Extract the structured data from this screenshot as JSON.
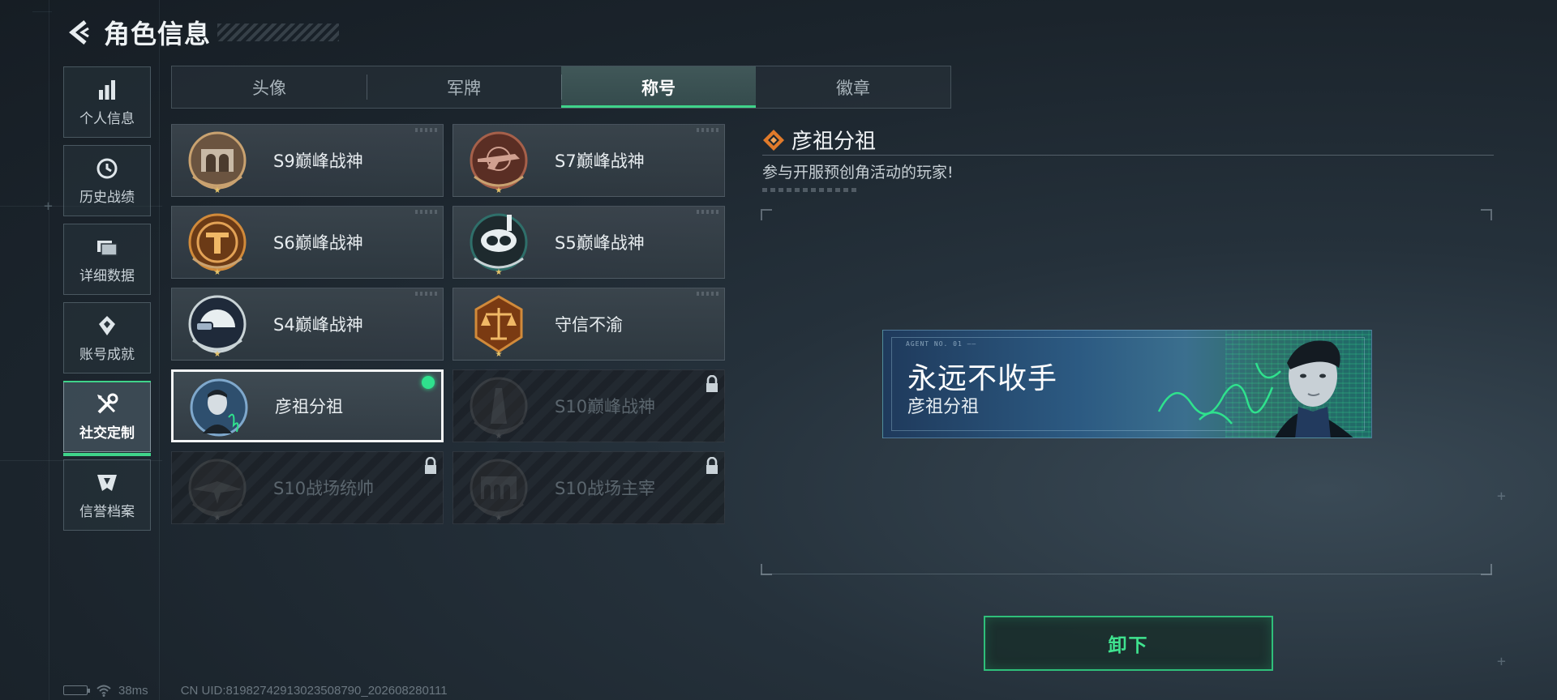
{
  "header": {
    "title": "角色信息"
  },
  "sidebar": {
    "items": [
      {
        "label": "个人信息",
        "icon": "bar-chart-icon",
        "active": false
      },
      {
        "label": "历史战绩",
        "icon": "clock-icon",
        "active": false
      },
      {
        "label": "详细数据",
        "icon": "folder-icon",
        "active": false
      },
      {
        "label": "账号成就",
        "icon": "achievement-icon",
        "active": false
      },
      {
        "label": "社交定制",
        "icon": "tools-icon",
        "active": true
      },
      {
        "label": "信誉档案",
        "icon": "credit-shield-icon",
        "active": false
      }
    ]
  },
  "tabs": [
    {
      "label": "头像",
      "active": false
    },
    {
      "label": "军牌",
      "active": false
    },
    {
      "label": "称号",
      "active": true
    },
    {
      "label": "徽章",
      "active": false
    }
  ],
  "titles": [
    {
      "label": "S9巅峰战神",
      "emblem": "arch-emblem-icon",
      "state": "owned"
    },
    {
      "label": "S7巅峰战神",
      "emblem": "rifle-emblem-icon",
      "state": "owned"
    },
    {
      "label": "S6巅峰战神",
      "emblem": "t-emblem-icon",
      "state": "owned"
    },
    {
      "label": "S5巅峰战神",
      "emblem": "diver-mask-emblem-icon",
      "state": "owned"
    },
    {
      "label": "S4巅峰战神",
      "emblem": "helmet-emblem-icon",
      "state": "owned"
    },
    {
      "label": "守信不渝",
      "emblem": "scales-emblem-icon",
      "state": "owned"
    },
    {
      "label": "彦祖分祖",
      "emblem": "portrait-emblem-icon",
      "state": "equipped"
    },
    {
      "label": "S10巅峰战神",
      "emblem": "tower-emblem-icon",
      "state": "locked"
    },
    {
      "label": "S10战场统帅",
      "emblem": "aircraft-emblem-icon",
      "state": "locked"
    },
    {
      "label": "S10战场主宰",
      "emblem": "colosseum-emblem-icon",
      "state": "locked"
    }
  ],
  "detail": {
    "title": "彦祖分祖",
    "icon": "diamond-rank-icon",
    "description": "参与开服预创角活动的玩家!",
    "banner": {
      "tiny_text": "AGENT NO. 01 ——",
      "main_text": "永远不收手",
      "sub_text": "彦祖分祖"
    }
  },
  "actions": {
    "unequip_label": "卸下"
  },
  "status": {
    "ping": "38ms",
    "uid": "CN UID:819827429130235087​90_202608280111"
  },
  "colors": {
    "accent": "#3fd38a",
    "equipped_dot": "#2fe18d",
    "button_text": "#3fe38f"
  }
}
